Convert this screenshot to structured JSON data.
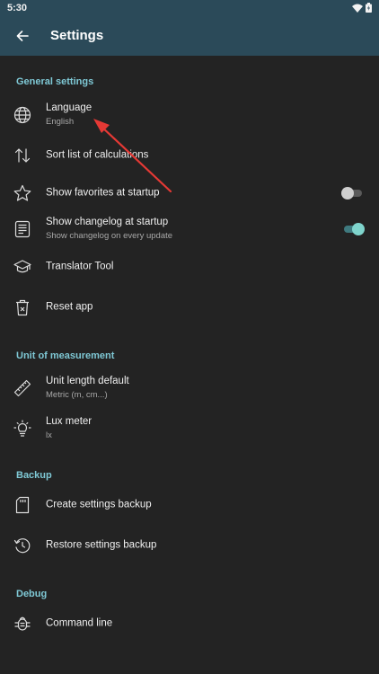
{
  "status_bar": {
    "time": "5:30"
  },
  "app_bar": {
    "title": "Settings"
  },
  "sections": {
    "general": {
      "title": "General settings",
      "language": {
        "label": "Language",
        "value": "English"
      },
      "sort_list": {
        "label": "Sort list of calculations"
      },
      "favorites": {
        "label": "Show favorites at startup",
        "enabled": false
      },
      "changelog": {
        "label": "Show changelog at startup",
        "summary": "Show changelog on every update",
        "enabled": true
      },
      "translator": {
        "label": "Translator Tool"
      },
      "reset": {
        "label": "Reset app"
      }
    },
    "unit": {
      "title": "Unit of measurement",
      "length": {
        "label": "Unit length default",
        "value": "Metric (m, cm...)"
      },
      "lux": {
        "label": "Lux meter",
        "value": "lx"
      }
    },
    "backup": {
      "title": "Backup",
      "create": {
        "label": "Create settings backup"
      },
      "restore": {
        "label": "Restore settings backup"
      }
    },
    "debug": {
      "title": "Debug",
      "command_line": {
        "label": "Command line"
      }
    }
  },
  "colors": {
    "app_bar": "#2b4a59",
    "background": "#232323",
    "section_accent": "#7fc9d6",
    "annotation_arrow": "#e53935"
  },
  "icons": {
    "back": "arrow-left-icon",
    "language": "globe-icon",
    "sort": "sort-arrows-icon",
    "favorites": "star-outline-icon",
    "changelog": "document-icon",
    "translator": "graduation-cap-icon",
    "reset": "trash-icon",
    "length": "ruler-icon",
    "lux": "lightbulb-icon",
    "create_backup": "sd-card-icon",
    "restore_backup": "restore-icon",
    "command_line": "bug-icon"
  }
}
